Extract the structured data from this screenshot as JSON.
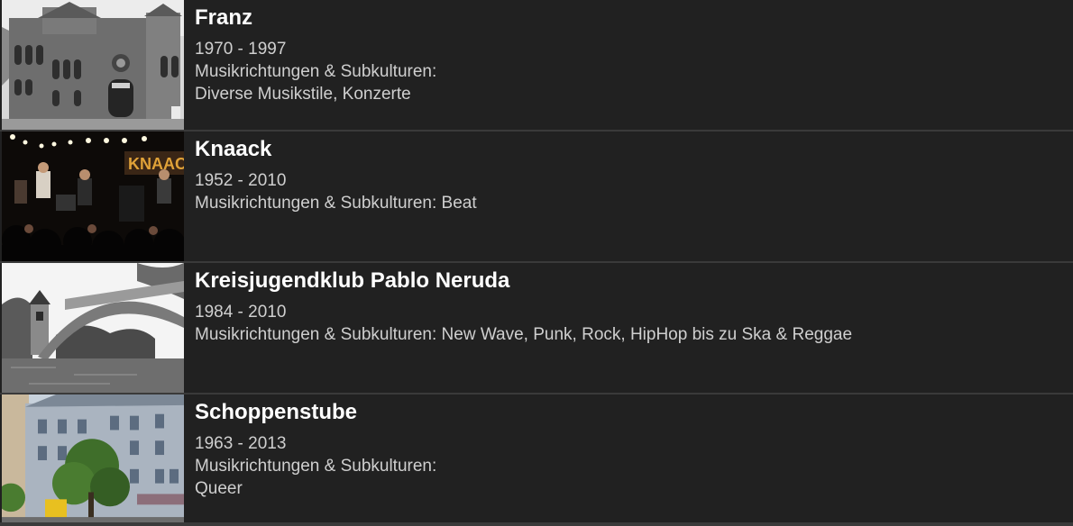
{
  "items": [
    {
      "title": "Franz",
      "years": "1970 - 1997",
      "genre_lines": [
        "Musikrichtungen & Subkulturen:",
        "Diverse Musikstile, Konzerte"
      ],
      "image": "photo-building-black-white"
    },
    {
      "title": "Knaack",
      "years": "1952 - 2010",
      "genre_lines": [
        "Musikrichtungen & Subkulturen: Beat"
      ],
      "image": "photo-concert-stage",
      "image_sign_text": "KNAACK"
    },
    {
      "title": "Kreisjugendklub Pablo Neruda",
      "years": "1984 - 2010",
      "genre_lines": [
        "Musikrichtungen & Subkulturen: New Wave, Punk, Rock, HipHop bis zu Ska & Reggae"
      ],
      "image": "photo-bridge-river"
    },
    {
      "title": "Schoppenstube",
      "years": "1963 - 2013",
      "genre_lines": [
        "Musikrichtungen & Subkulturen:",
        "Queer"
      ],
      "image": "photo-street-building"
    }
  ]
}
